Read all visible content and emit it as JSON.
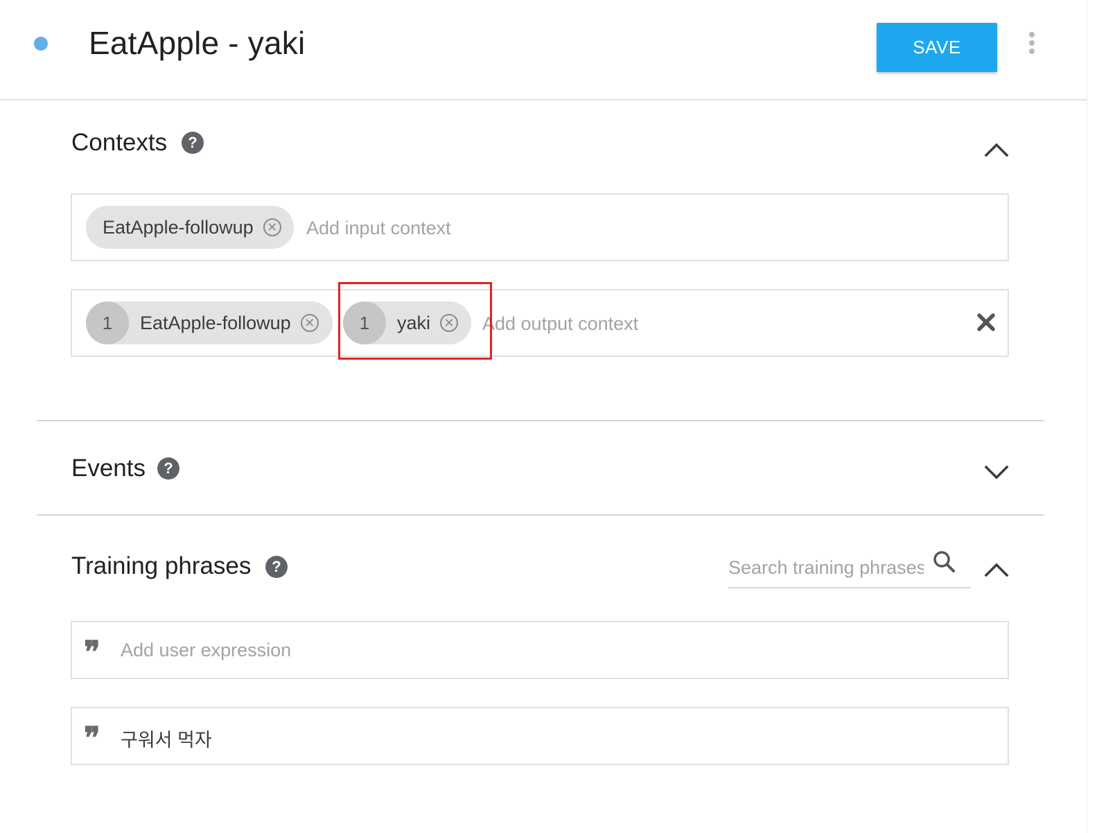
{
  "header": {
    "title": "EatApple - yaki",
    "save_label": "SAVE",
    "status_color": "#64aee8",
    "accent_color": "#1ea7ef"
  },
  "contexts": {
    "title": "Contexts",
    "help_icon": "question-circle-icon",
    "expanded": true,
    "input": {
      "chips": [
        {
          "label": "EatApple-followup"
        }
      ],
      "placeholder": "Add input context"
    },
    "output": {
      "chips": [
        {
          "lifespan": "1",
          "label": "EatApple-followup"
        },
        {
          "lifespan": "1",
          "label": "yaki"
        }
      ],
      "placeholder": "Add output context"
    }
  },
  "events": {
    "title": "Events",
    "expanded": false
  },
  "training": {
    "title": "Training phrases",
    "search_placeholder": "Search training phrases",
    "expanded": true,
    "add_placeholder": "Add user expression",
    "quote_glyph": "❞",
    "phrases": [
      {
        "text": "구워서 먹자"
      }
    ]
  }
}
